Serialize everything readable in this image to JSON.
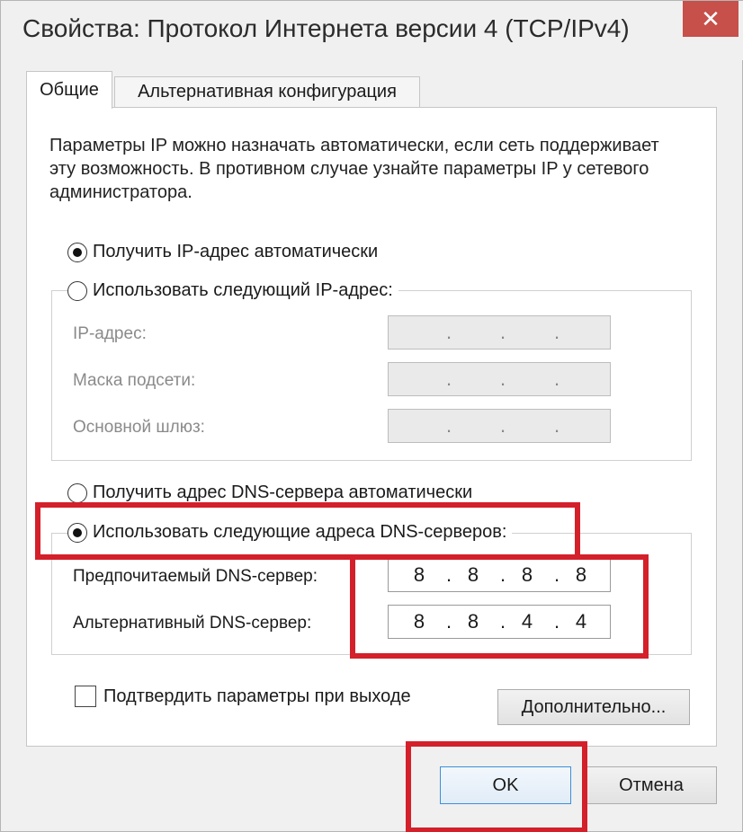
{
  "window": {
    "title": "Свойства: Протокол Интернета версии 4 (TCP/IPv4)",
    "close_glyph": "✕"
  },
  "tabs": [
    {
      "label": "Общие",
      "active": true
    },
    {
      "label": "Альтернативная конфигурация",
      "active": false
    }
  ],
  "description": "Параметры IP можно назначать автоматически, если сеть поддерживает эту возможность. В противном случае узнайте параметры IP у сетевого администратора.",
  "ip_mode": {
    "auto_label": "Получить IP-адрес автоматически",
    "manual_label": "Использовать следующий IP-адрес:",
    "selected": "auto"
  },
  "ip_fields": [
    {
      "label": "IP-адрес:",
      "value": [
        "",
        "",
        "",
        ""
      ]
    },
    {
      "label": "Маска подсети:",
      "value": [
        "",
        "",
        "",
        ""
      ]
    },
    {
      "label": "Основной шлюз:",
      "value": [
        "",
        "",
        "",
        ""
      ]
    }
  ],
  "dns_mode": {
    "auto_label": "Получить адрес DNS-сервера автоматически",
    "manual_label": "Использовать следующие адреса DNS-серверов:",
    "selected": "manual"
  },
  "dns_fields": [
    {
      "label": "Предпочитаемый DNS-сервер:",
      "value": [
        "8",
        "8",
        "8",
        "8"
      ]
    },
    {
      "label": "Альтернативный DNS-сервер:",
      "value": [
        "8",
        "8",
        "4",
        "4"
      ]
    }
  ],
  "validate_label": "Подтвердить параметры при выходе",
  "validate_checked": false,
  "buttons": {
    "advanced": "Дополнительно...",
    "ok": "OK",
    "cancel": "Отмена"
  },
  "ip_separator": ".",
  "colors": {
    "highlight": "#d3202a",
    "close_button": "#c7504a",
    "ok_border": "#3c8fd8"
  }
}
